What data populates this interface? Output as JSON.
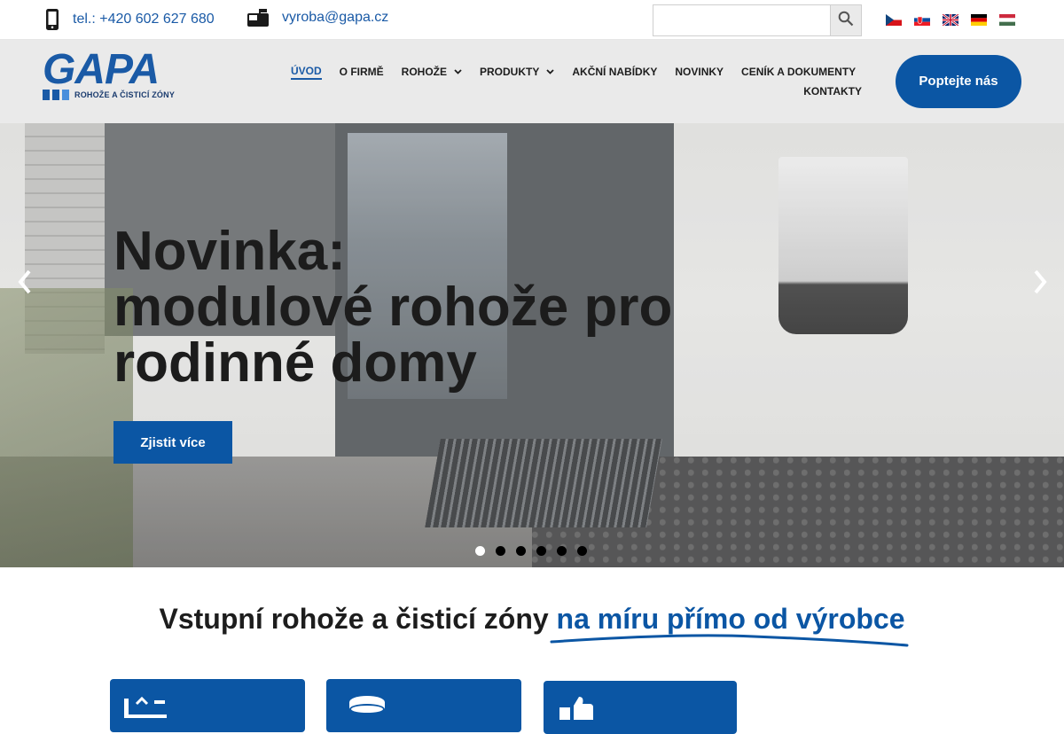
{
  "topbar": {
    "phone": "tel.: +420 602 627 680",
    "email": "vyroba@gapa.cz",
    "search_placeholder": "",
    "languages": [
      "cs",
      "sk",
      "en",
      "de",
      "hu"
    ]
  },
  "logo": {
    "word": "GAPA",
    "tagline": "ROHOŽE A ČISTICÍ ZÓNY"
  },
  "nav": {
    "items": [
      {
        "label": "ÚVOD",
        "active": true
      },
      {
        "label": "O FIRMĚ"
      },
      {
        "label": "ROHOŽE",
        "dropdown": true
      },
      {
        "label": "PRODUKTY",
        "dropdown": true
      },
      {
        "label": "AKČNÍ NABÍDKY"
      },
      {
        "label": "NOVINKY"
      },
      {
        "label": "CENÍK A DOKUMENTY"
      },
      {
        "label": "KONTAKTY"
      }
    ],
    "cta": "Poptejte nás"
  },
  "hero": {
    "line1": "Novinka:",
    "line2": "modulové rohože pro",
    "line3": "rodinné domy",
    "button": "Zjistit více",
    "slides": 6,
    "active_slide": 1
  },
  "intro": {
    "text": "Vstupní rohože a čisticí zóny",
    "highlight": "na míru přímo od výrobce"
  },
  "colors": {
    "brand_blue": "#0b56a4",
    "text_dark": "#1d1d1d"
  }
}
